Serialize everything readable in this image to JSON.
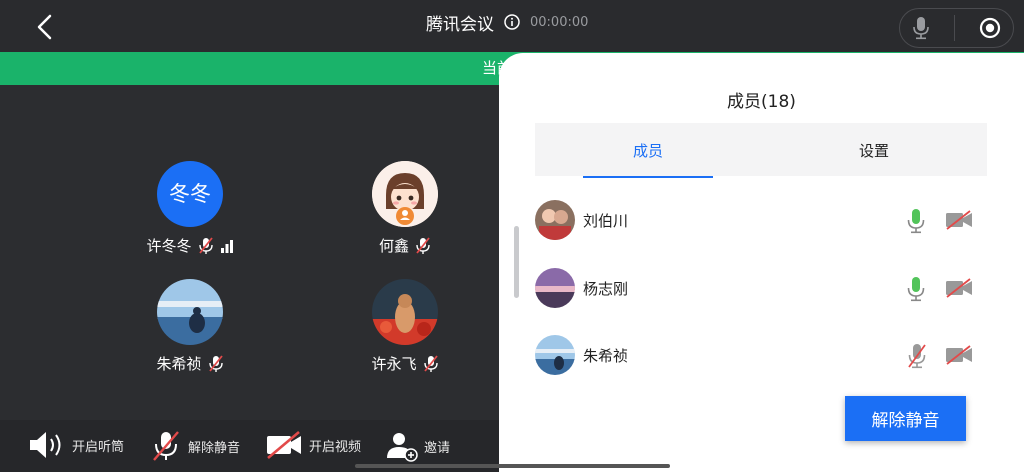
{
  "header": {
    "title": "腾讯会议",
    "timer": "00:00:00",
    "back_icon": "chevron-left-icon",
    "info_icon": "info-icon",
    "mic_icon": "microphone-icon",
    "record_icon": "record-icon"
  },
  "banner": {
    "text": "当前发言"
  },
  "participants": [
    {
      "name": "许冬冬",
      "avatar_text": "冬冬",
      "mic_muted": true,
      "signal": true
    },
    {
      "name": "何鑫",
      "mic_muted": true
    },
    {
      "name": "朱希祯",
      "mic_muted": true
    },
    {
      "name": "许永飞",
      "mic_muted": true
    }
  ],
  "toolbar": {
    "speaker_label": "开启听筒",
    "unmute_label": "解除静音",
    "video_label": "开启视频",
    "invite_label": "邀请"
  },
  "panel": {
    "title": "成员(18)",
    "tabs": [
      {
        "label": "成员",
        "active": true
      },
      {
        "label": "设置",
        "active": false
      }
    ],
    "members": [
      {
        "name": "刘伯川",
        "mic": "active"
      },
      {
        "name": "杨志刚",
        "mic": "active"
      },
      {
        "name": "朱希祯",
        "mic": "muted"
      }
    ],
    "unmute_button": "解除静音"
  },
  "colors": {
    "accent": "#1b6ff5",
    "speaking": "#1ab36a",
    "mic_active": "#52c45a",
    "muted_red": "#e24a4a"
  }
}
